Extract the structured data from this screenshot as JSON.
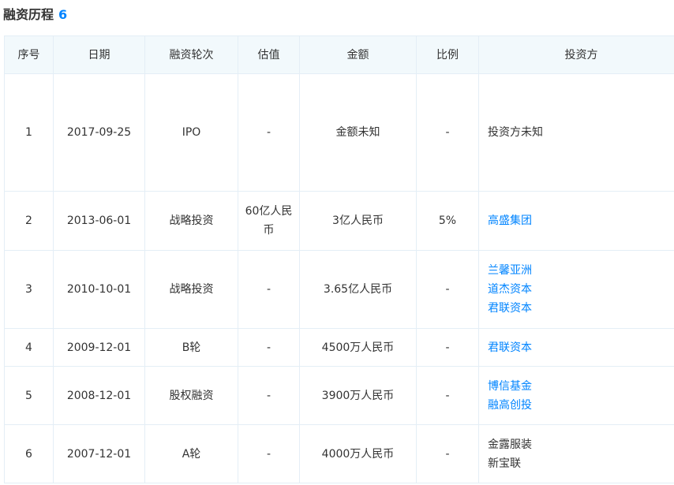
{
  "section": {
    "title": "融资历程",
    "count": "6"
  },
  "table": {
    "headers": [
      "序号",
      "日期",
      "融资轮次",
      "估值",
      "金额",
      "比例",
      "投资方"
    ],
    "rows": [
      {
        "no": "1",
        "date": "2017-09-25",
        "round": "IPO",
        "valuation": "-",
        "amount": "金额未知",
        "ratio": "-",
        "investors": [
          {
            "name": "投资方未知",
            "link": false
          }
        ]
      },
      {
        "no": "2",
        "date": "2013-06-01",
        "round": "战略投资",
        "valuation": "60亿人民币",
        "amount": "3亿人民币",
        "ratio": "5%",
        "investors": [
          {
            "name": "高盛集团",
            "link": true
          }
        ]
      },
      {
        "no": "3",
        "date": "2010-10-01",
        "round": "战略投资",
        "valuation": "-",
        "amount": "3.65亿人民币",
        "ratio": "-",
        "investors": [
          {
            "name": "兰馨亚洲",
            "link": true
          },
          {
            "name": "道杰资本",
            "link": true
          },
          {
            "name": "君联资本",
            "link": true
          }
        ]
      },
      {
        "no": "4",
        "date": "2009-12-01",
        "round": "B轮",
        "valuation": "-",
        "amount": "4500万人民币",
        "ratio": "-",
        "investors": [
          {
            "name": "君联资本",
            "link": true
          }
        ]
      },
      {
        "no": "5",
        "date": "2008-12-01",
        "round": "股权融资",
        "valuation": "-",
        "amount": "3900万人民币",
        "ratio": "-",
        "investors": [
          {
            "name": "博信基金",
            "link": true
          },
          {
            "name": "融高创投",
            "link": true
          }
        ]
      },
      {
        "no": "6",
        "date": "2007-12-01",
        "round": "A轮",
        "valuation": "-",
        "amount": "4000万人民币",
        "ratio": "-",
        "investors": [
          {
            "name": "金露服装",
            "link": false
          },
          {
            "name": "新宝联",
            "link": false
          }
        ]
      }
    ]
  },
  "colors": {
    "link": "#0084ff",
    "header_bg": "#f2f9fc",
    "border": "#e4eef6",
    "text": "#333333"
  }
}
